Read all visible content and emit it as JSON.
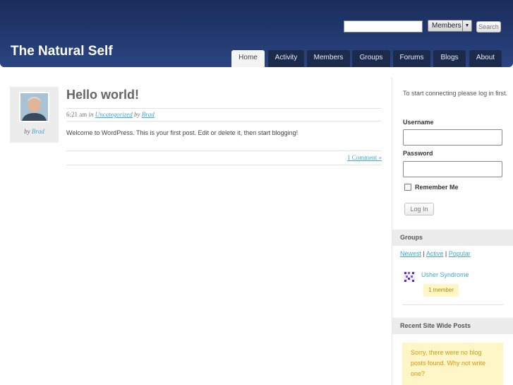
{
  "header": {
    "site_title": "The Natural Self",
    "search": {
      "input_value": "",
      "select_value": "Members",
      "button_label": "Search"
    },
    "nav": [
      {
        "label": "Home",
        "active": true
      },
      {
        "label": "Activity",
        "active": false
      },
      {
        "label": "Members",
        "active": false
      },
      {
        "label": "Groups",
        "active": false
      },
      {
        "label": "Forums",
        "active": false
      },
      {
        "label": "Blogs",
        "active": false
      },
      {
        "label": "About",
        "active": false
      }
    ]
  },
  "post": {
    "author_prefix": "by",
    "author": "Brad",
    "title": "Hello world!",
    "time": "6:21 am",
    "meta_in": "in",
    "category": "Uncategorized",
    "meta_by": "by",
    "body": "Welcome to WordPress. This is your first post. Edit or delete it, then start blogging!",
    "comments_link": "1 Comment »"
  },
  "sidebar": {
    "login": {
      "intro": "To start connecting please log in first.",
      "username_label": "Username",
      "password_label": "Password",
      "remember_label": "Remember Me",
      "login_button": "Log In"
    },
    "groups": {
      "heading": "Groups",
      "filters": [
        "Newest",
        "Active",
        "Popular"
      ],
      "separator": "|",
      "items": [
        {
          "name": "Usher Syndrome",
          "members": "1 member"
        }
      ]
    },
    "recent_posts": {
      "heading": "Recent Site Wide Posts",
      "notice": "Sorry, there were no blog posts found. Why not write one?"
    }
  },
  "colors": {
    "header_bg": "#233a70",
    "nav_tab_bg": "#1c2a4c",
    "link": "#3ea8d8",
    "notice_bg": "#fff6c8",
    "notice_text": "#d4970c"
  }
}
